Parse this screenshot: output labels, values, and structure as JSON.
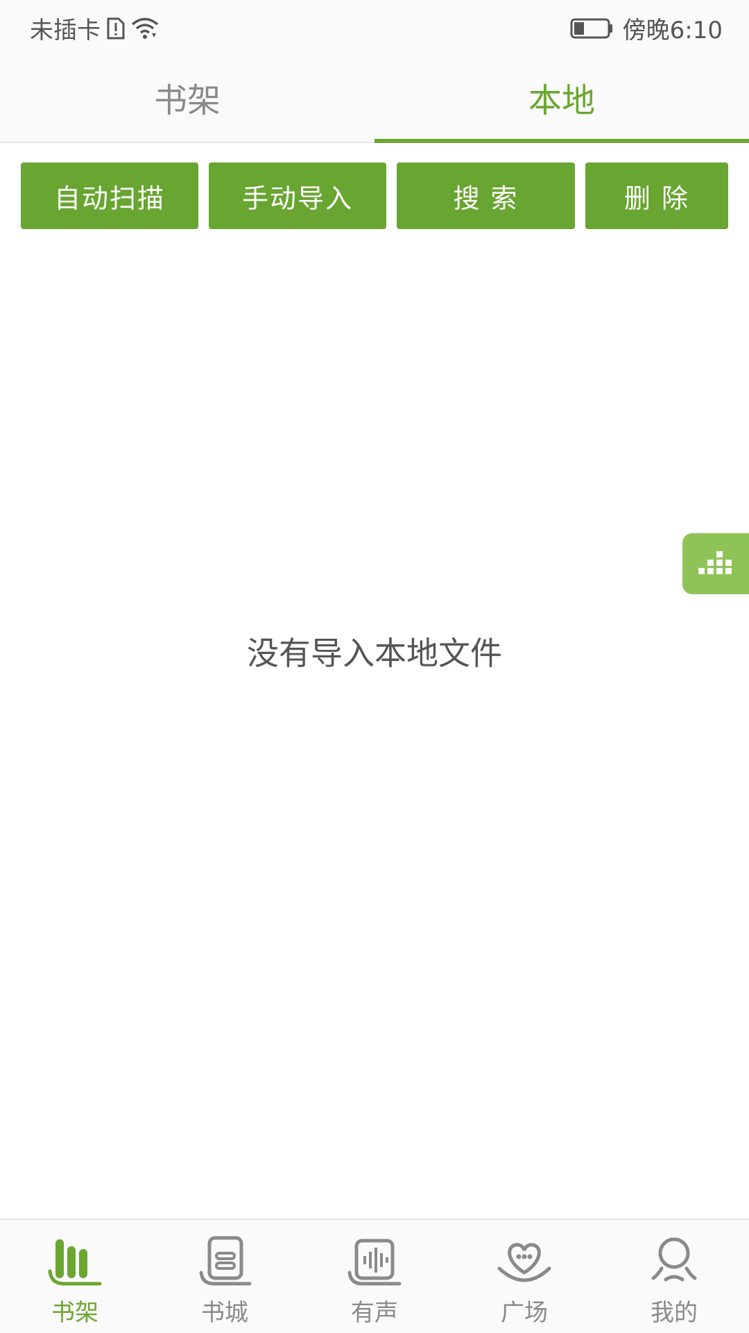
{
  "status_bar": {
    "carrier": "未插卡",
    "time": "傍晚6:10",
    "icons": [
      "sim-alert-icon",
      "wifi-icon",
      "battery-icon"
    ]
  },
  "top_tabs": [
    {
      "label": "书架",
      "active": false
    },
    {
      "label": "本地",
      "active": true
    }
  ],
  "actions": {
    "auto_scan": "自动扫描",
    "manual_import": "手动导入",
    "search": "搜 索",
    "delete": "删 除"
  },
  "empty_message": "没有导入本地文件",
  "floating_button": {
    "icon": "equalizer-icon"
  },
  "bottom_nav": [
    {
      "label": "书架",
      "icon": "bookshelf-icon",
      "active": true
    },
    {
      "label": "书城",
      "icon": "bookstore-icon",
      "active": false
    },
    {
      "label": "有声",
      "icon": "audio-icon",
      "active": false
    },
    {
      "label": "广场",
      "icon": "heart-square-icon",
      "active": false
    },
    {
      "label": "我的",
      "icon": "profile-icon",
      "active": false
    }
  ],
  "colors": {
    "accent": "#6aa630",
    "button": "#68a531",
    "float_button": "#8fc358",
    "inactive_text": "#8a8a8a"
  }
}
